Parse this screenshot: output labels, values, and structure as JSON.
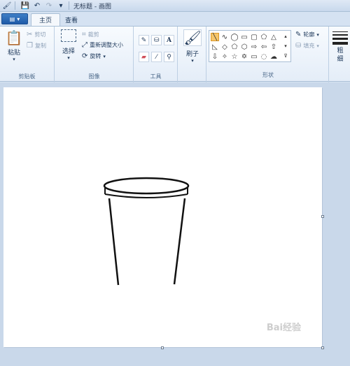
{
  "window": {
    "title": "无标题 - 画图"
  },
  "tabs": [
    {
      "label": "主页",
      "active": true
    },
    {
      "label": "查看",
      "active": false
    }
  ],
  "clipboard": {
    "paste": "粘贴",
    "cut": "剪切",
    "copy": "复制",
    "group": "剪贴板"
  },
  "image": {
    "select": "选择",
    "crop": "裁剪",
    "resize": "重新调整大小",
    "rotate": "旋转",
    "group": "图像"
  },
  "tools": {
    "group": "工具"
  },
  "brushes": {
    "label": "刷子"
  },
  "shapes": {
    "outline": "轮廓",
    "fill": "填充",
    "group": "形状"
  },
  "size": {
    "label": "粗细"
  },
  "watermark": {
    "text": "Bai经验"
  },
  "colors": {
    "accent": "#1e5aa8",
    "canvas": "#ffffff",
    "workspace": "#c9d8ea"
  }
}
